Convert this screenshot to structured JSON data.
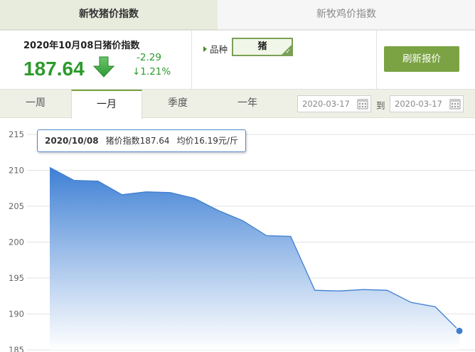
{
  "top_tabs": {
    "pig": "新牧猪价指数",
    "chicken": "新牧鸡价指数"
  },
  "index": {
    "title": "2020年10月08日猪价指数",
    "value": "187.64",
    "change": "-2.29",
    "pct": "↓1.21%",
    "color": "#2c9a2c"
  },
  "variety": {
    "label": "品种",
    "selected": "猪"
  },
  "refresh_label": "刷新报价",
  "periods": [
    "一周",
    "一月",
    "季度",
    "一年"
  ],
  "active_period": "一月",
  "dates": {
    "from": "2020-03-17",
    "to_label": "到",
    "to": "2020-03-17"
  },
  "tooltip": {
    "date": "2020/10/08",
    "index_text": "猪价指数187.64",
    "price_text": "均价16.19元/斤"
  },
  "chart_data": {
    "type": "area",
    "ylim": [
      185,
      215
    ],
    "yticks": [
      "215",
      "210",
      "205",
      "200",
      "195",
      "190",
      "185"
    ],
    "values": [
      210.4,
      208.6,
      208.5,
      206.6,
      207.0,
      206.9,
      206.1,
      204.4,
      203.0,
      200.9,
      200.8,
      193.3,
      193.2,
      193.4,
      193.3,
      191.6,
      191.0,
      187.64
    ],
    "line_color": "#3f7fd0",
    "fill_top": "#3d7fd4",
    "fill_bottom": "#ffffff",
    "grid": true,
    "highlight_last": true
  }
}
